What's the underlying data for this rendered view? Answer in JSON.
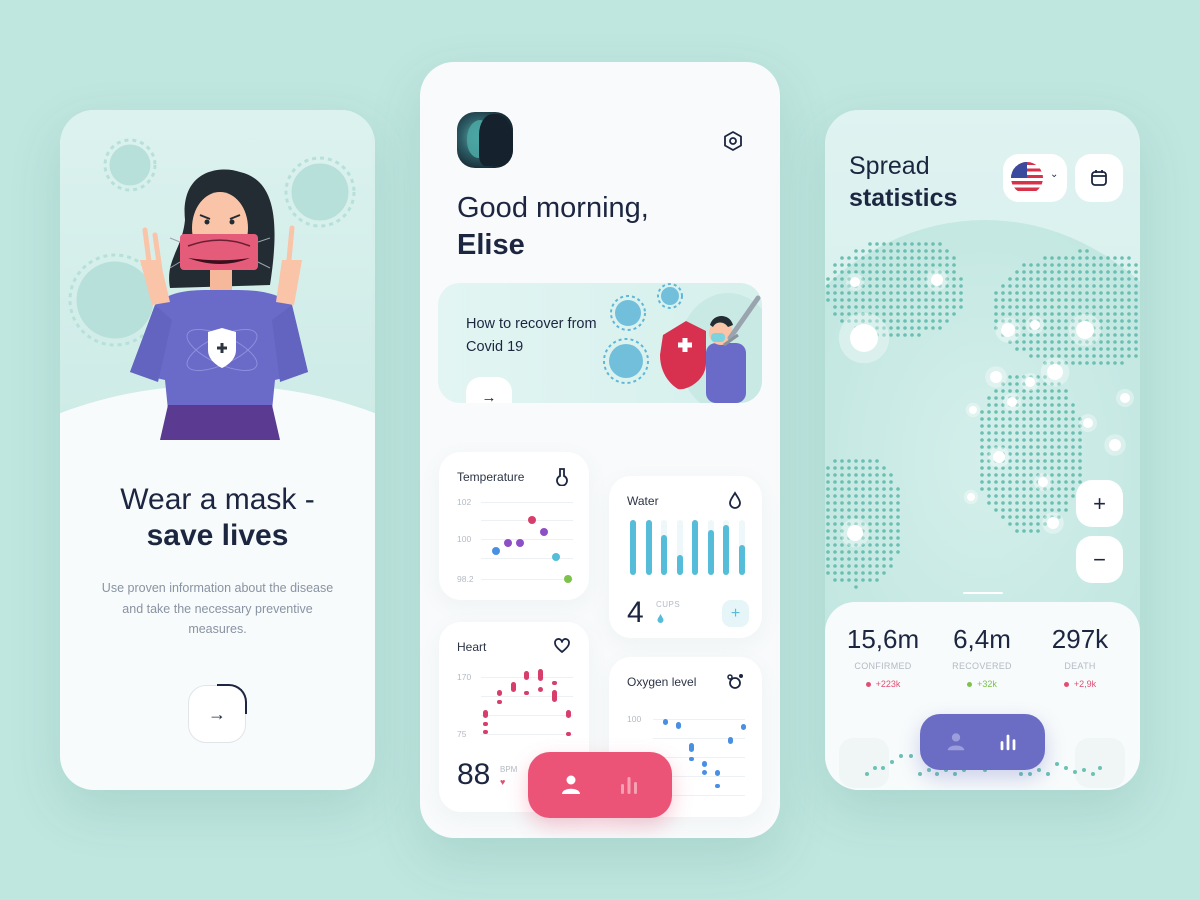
{
  "onboarding": {
    "title_line1": "Wear a mask -",
    "title_line2": "save lives",
    "description": "Use proven information about the disease and take the necessary preventive measures.",
    "next_button_icon": "→",
    "progress_fraction": 0.25
  },
  "dashboard": {
    "greeting": "Good morning,",
    "user_name": "Elise",
    "settings_icon": "hexagon-settings-icon",
    "banner": {
      "title": "How to recover from Covid 19",
      "arrow": "→"
    },
    "temperature": {
      "title": "Temperature",
      "axis_labels": [
        "102",
        "100",
        "98.2"
      ],
      "points": [
        {
          "value": 99.6,
          "color": "#4a90e2"
        },
        {
          "value": 100.0,
          "color": "#8e4fc6"
        },
        {
          "value": 100.0,
          "color": "#8e4fc6"
        },
        {
          "value": 101.1,
          "color": "#d83e6b"
        },
        {
          "value": 100.5,
          "color": "#8e4fc6"
        },
        {
          "value": 99.3,
          "color": "#55bcd9"
        },
        {
          "value": 98.2,
          "color": "#7dc24b"
        }
      ]
    },
    "water": {
      "title": "Water",
      "cups": "4",
      "unit": "CUPS",
      "add_label": "+",
      "levels": [
        1.0,
        1.0,
        0.73,
        0.36,
        1.0,
        0.82,
        0.91,
        0.55
      ]
    },
    "heart": {
      "title": "Heart",
      "bpm": "88",
      "unit": "BPM",
      "heart_glyph": "♥",
      "axis_labels": [
        "170",
        "75"
      ]
    },
    "oxygen": {
      "title": "Oxygen level",
      "axis_labels": [
        "100"
      ]
    },
    "nav": {
      "profile_icon": "person-icon",
      "stats_icon": "bar-chart-icon"
    }
  },
  "statistics": {
    "title_line1": "Spread",
    "title_line2": "statistics",
    "country_flag": "US",
    "chevron": "⌄",
    "zoom_in": "+",
    "zoom_out": "−",
    "stats": [
      {
        "value": "15,6m",
        "label": "CONFIRMED",
        "delta": "+223k",
        "color": "#e14e74"
      },
      {
        "value": "6,4m",
        "label": "RECOVERED",
        "delta": "+32k",
        "color": "#7dc24b"
      },
      {
        "value": "297k",
        "label": "DEATH",
        "delta": "+2,9k",
        "color": "#e14e74"
      }
    ]
  }
}
